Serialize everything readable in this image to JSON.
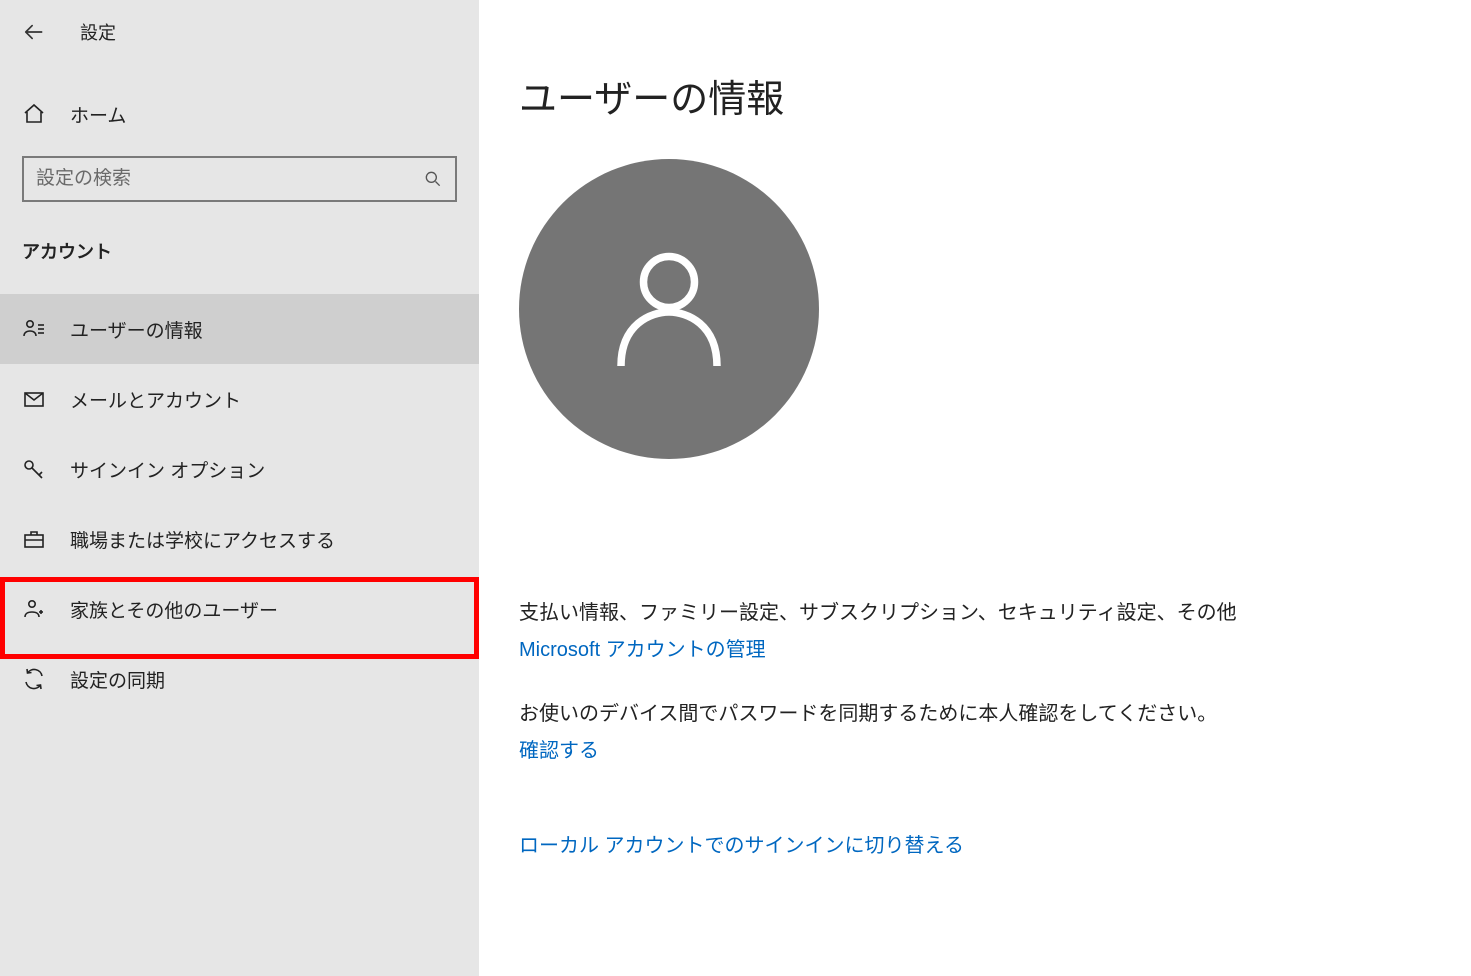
{
  "window": {
    "title": "設定"
  },
  "sidebar": {
    "home_label": "ホーム",
    "search_placeholder": "設定の検索",
    "category_label": "アカウント",
    "items": [
      {
        "label": "ユーザーの情報"
      },
      {
        "label": "メールとアカウント"
      },
      {
        "label": "サインイン オプション"
      },
      {
        "label": "職場または学校にアクセスする"
      },
      {
        "label": "家族とその他のユーザー"
      },
      {
        "label": "設定の同期"
      }
    ]
  },
  "main": {
    "heading": "ユーザーの情報",
    "billing_info_text": "支払い情報、ファミリー設定、サブスクリプション、セキュリティ設定、その他",
    "manage_account_link": "Microsoft アカウントの管理",
    "verify_text": "お使いのデバイス間でパスワードを同期するために本人確認をしてください。",
    "verify_link": "確認する",
    "switch_local_link": "ローカル アカウントでのサインインに切り替える"
  }
}
